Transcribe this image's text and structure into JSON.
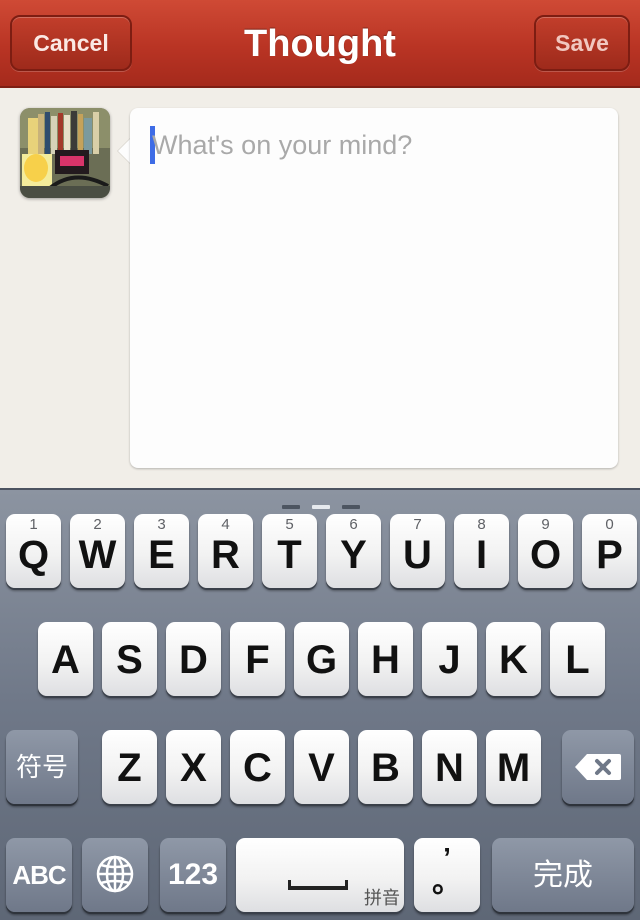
{
  "nav": {
    "cancel_label": "Cancel",
    "title": "Thought",
    "save_label": "Save"
  },
  "compose": {
    "placeholder": "What's on your mind?"
  },
  "keyboard": {
    "row1": [
      {
        "letter": "Q",
        "num": "1"
      },
      {
        "letter": "W",
        "num": "2"
      },
      {
        "letter": "E",
        "num": "3"
      },
      {
        "letter": "R",
        "num": "4"
      },
      {
        "letter": "T",
        "num": "5"
      },
      {
        "letter": "Y",
        "num": "6"
      },
      {
        "letter": "U",
        "num": "7"
      },
      {
        "letter": "I",
        "num": "8"
      },
      {
        "letter": "O",
        "num": "9"
      },
      {
        "letter": "P",
        "num": "0"
      }
    ],
    "row2": [
      "A",
      "S",
      "D",
      "F",
      "G",
      "H",
      "J",
      "K",
      "L"
    ],
    "row3": [
      "Z",
      "X",
      "C",
      "V",
      "B",
      "N",
      "M"
    ],
    "symbols_label": "符号",
    "abc_label": "ABC",
    "numbers_label": "123",
    "space_sublabel": "拼音",
    "punct_top": "’",
    "punct_bottom": "。",
    "done_label": "完成",
    "icons": {
      "globe": "globe-icon",
      "backspace": "backspace-icon"
    }
  }
}
